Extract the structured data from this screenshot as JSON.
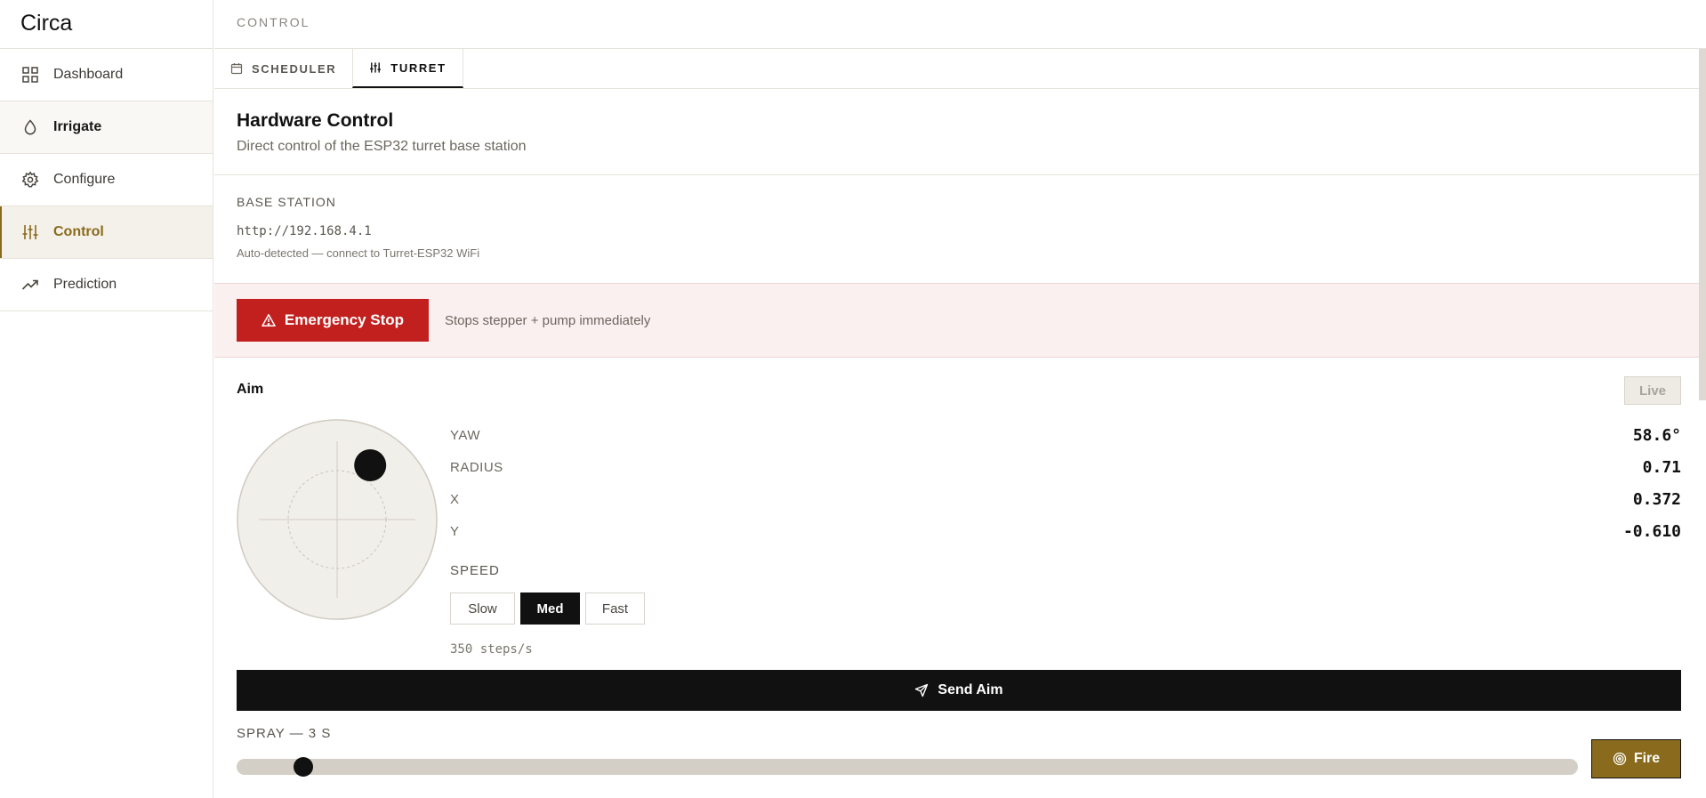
{
  "app": {
    "brand": "Circa"
  },
  "sidebar": {
    "items": [
      {
        "label": "Dashboard",
        "icon": "grid-icon"
      },
      {
        "label": "Irrigate",
        "icon": "droplet-icon"
      },
      {
        "label": "Configure",
        "icon": "gear-icon"
      },
      {
        "label": "Control",
        "icon": "sliders-icon",
        "active": true
      },
      {
        "label": "Prediction",
        "icon": "trending-up-icon"
      }
    ]
  },
  "header": {
    "title": "CONTROL"
  },
  "tabs": [
    {
      "label": "SCHEDULER",
      "icon": "calendar-icon"
    },
    {
      "label": "TURRET",
      "icon": "sliders-icon",
      "active": true
    }
  ],
  "section": {
    "title": "Hardware Control",
    "subtitle": "Direct control of the ESP32 turret base station"
  },
  "base_station": {
    "label": "BASE STATION",
    "url": "http://192.168.4.1",
    "hint": "Auto-detected — connect to Turret-ESP32 WiFi"
  },
  "emergency": {
    "button_label": "Emergency Stop",
    "note": "Stops stepper + pump immediately"
  },
  "aim": {
    "title": "Aim",
    "live_label": "Live",
    "readouts": [
      {
        "label": "YAW",
        "value": "58.6°"
      },
      {
        "label": "RADIUS",
        "value": "0.71"
      },
      {
        "label": "X",
        "value": "0.372"
      },
      {
        "label": "Y",
        "value": "-0.610"
      }
    ],
    "joystick": {
      "x": 0.372,
      "y": -0.61
    },
    "speed_label": "SPEED",
    "speed_options": [
      "Slow",
      "Med",
      "Fast"
    ],
    "speed_selected": "Med",
    "steps": "350 steps/s",
    "send_label": "Send Aim"
  },
  "spray": {
    "label": "SPRAY — 3 S",
    "value": 3,
    "min": 0,
    "max": 60,
    "fire_label": "Fire"
  }
}
